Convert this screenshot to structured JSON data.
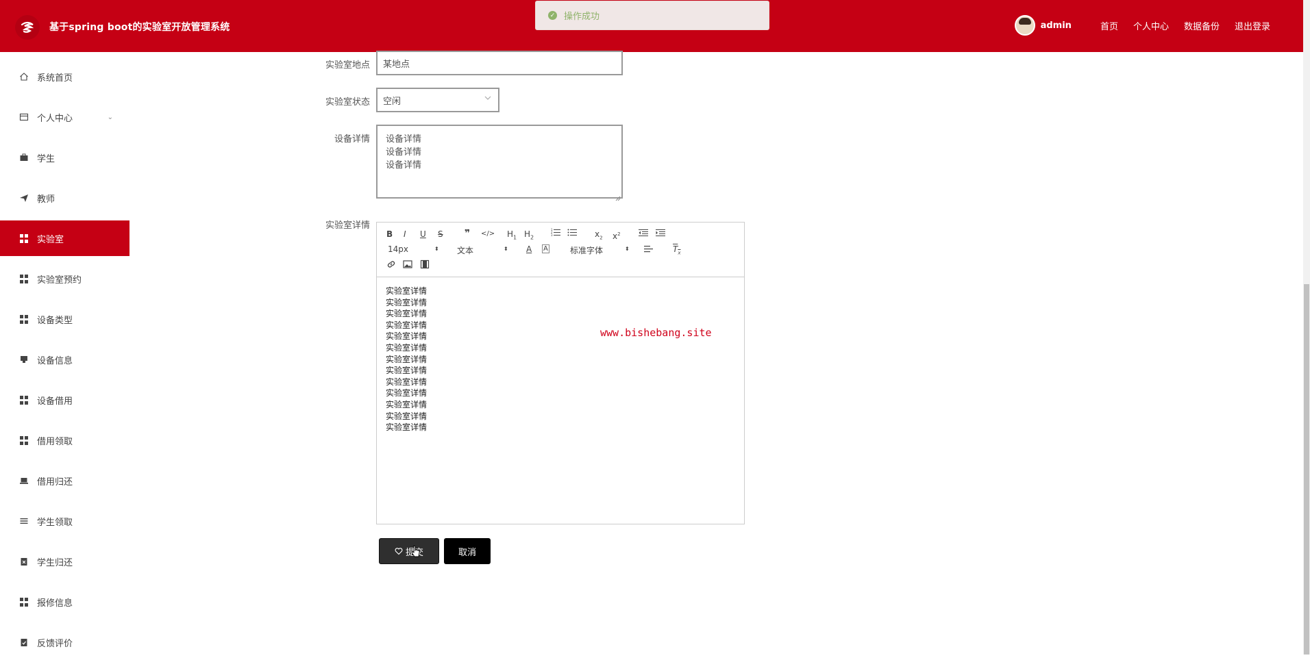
{
  "header": {
    "title": "基于spring boot的实验室开放管理系统",
    "toast": "操作成功",
    "username": "admin",
    "nav": [
      "首页",
      "个人中心",
      "数据备份",
      "退出登录"
    ]
  },
  "sidebar": {
    "items": [
      {
        "label": "系统首页",
        "icon": "home-icon"
      },
      {
        "label": "个人中心",
        "icon": "card-icon"
      },
      {
        "label": "学生",
        "icon": "briefcase-icon"
      },
      {
        "label": "教师",
        "icon": "send-icon"
      },
      {
        "label": "实验室",
        "icon": "grid-icon",
        "active": true
      },
      {
        "label": "实验室预约",
        "icon": "grid-icon"
      },
      {
        "label": "设备类型",
        "icon": "grid-icon"
      },
      {
        "label": "设备信息",
        "icon": "monitor-icon"
      },
      {
        "label": "设备借用",
        "icon": "grid-icon"
      },
      {
        "label": "借用领取",
        "icon": "grid-icon"
      },
      {
        "label": "借用归还",
        "icon": "laptop-icon"
      },
      {
        "label": "学生领取",
        "icon": "list-icon"
      },
      {
        "label": "学生归还",
        "icon": "clipboard-x-icon"
      },
      {
        "label": "报修信息",
        "icon": "grid-icon"
      },
      {
        "label": "反馈评价",
        "icon": "clipboard-check-icon"
      }
    ]
  },
  "form": {
    "location_label": "实验室地点",
    "location_value": "某地点",
    "status_label": "实验室状态",
    "status_value": "空闲",
    "device_label": "设备详情",
    "device_value": "设备详情\n设备详情\n设备详情",
    "lab_detail_label": "实验室详情"
  },
  "editor": {
    "font_size": "14px",
    "text_type": "文本",
    "font_family": "标准字体",
    "content_line": "实验室详情",
    "content_count": 13,
    "watermark": "www.bishebang.site"
  },
  "buttons": {
    "submit": "提交",
    "cancel": "取消"
  },
  "colors": {
    "brand": "#c50014",
    "toast_text": "#8fb36a"
  }
}
